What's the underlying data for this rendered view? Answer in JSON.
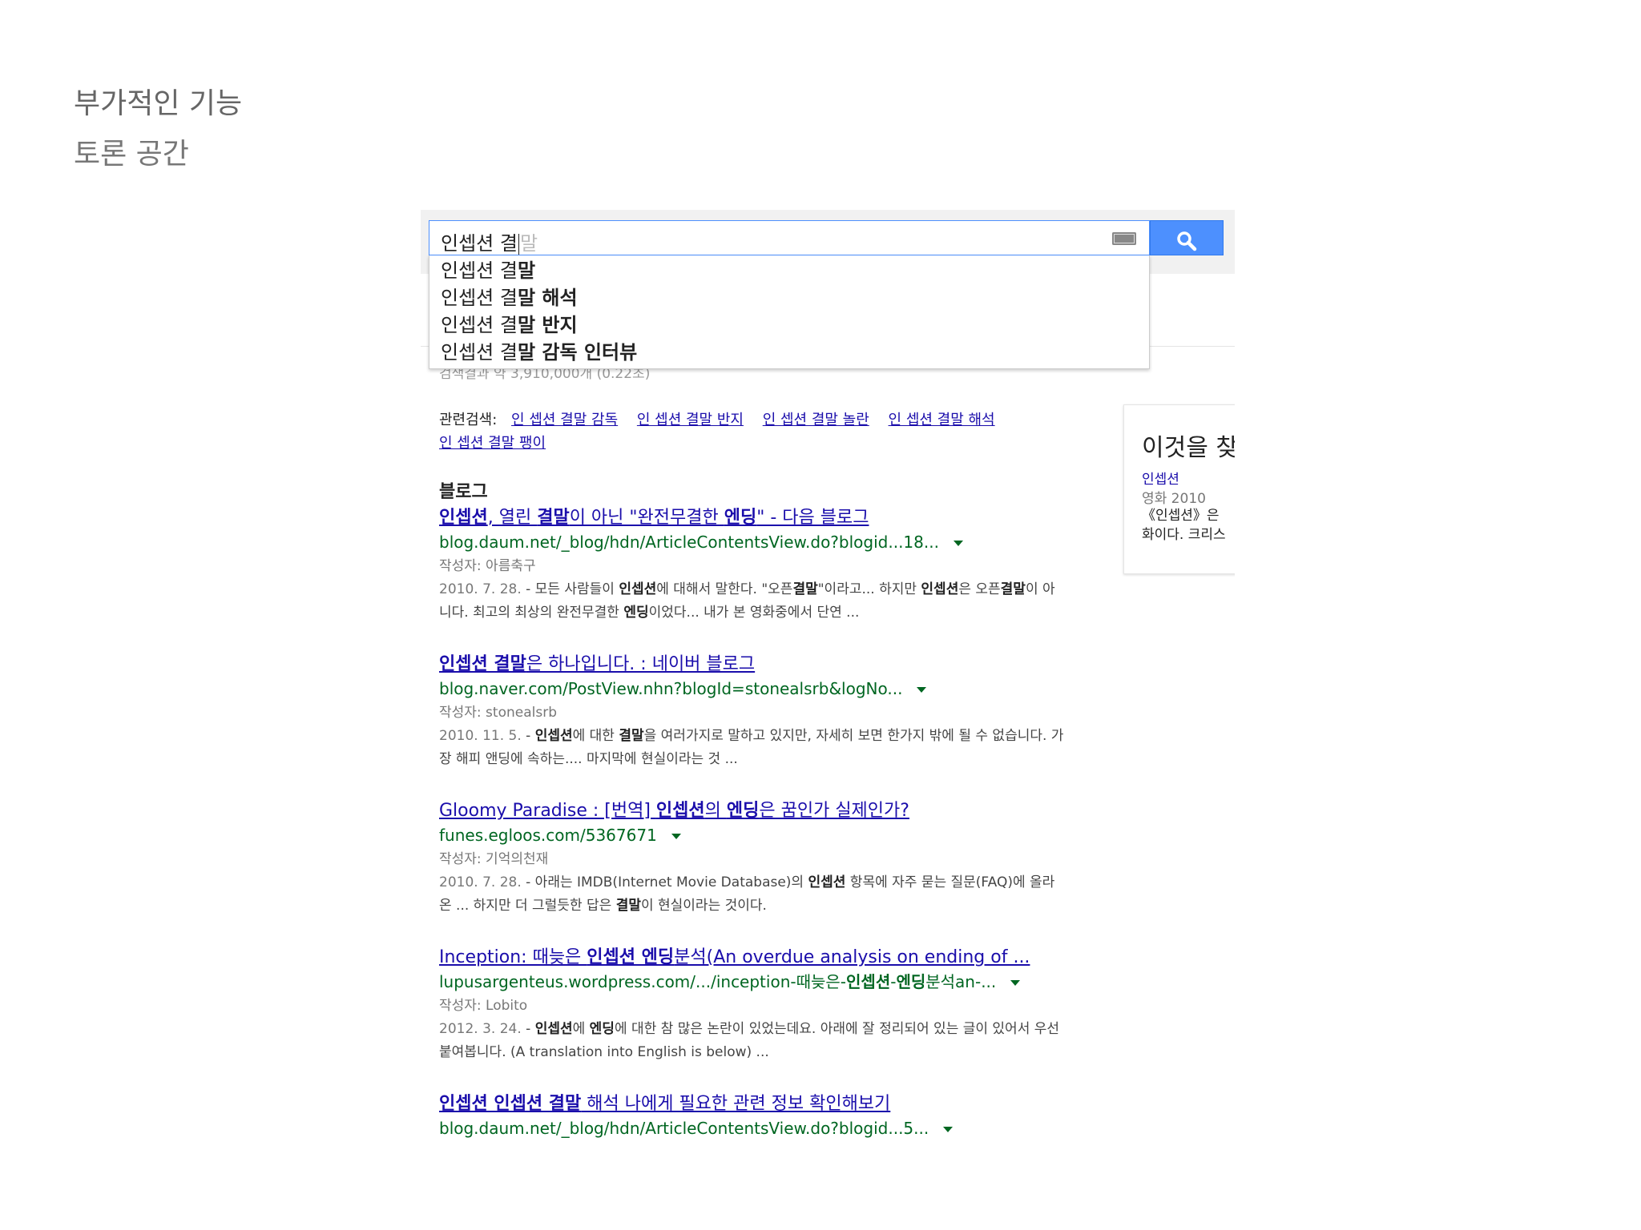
{
  "slide": {
    "heading": "부가적인 기능",
    "subheading": "토론 공간"
  },
  "search": {
    "query": "인셉션 결",
    "hint": "말",
    "keyboard_icon": "keyboard-icon",
    "button_icon": "search-icon",
    "accent_color": "#4d90fe"
  },
  "suggestions": [
    {
      "prefix": "인셉션 결",
      "suffix": "말"
    },
    {
      "prefix": "인셉션 결",
      "suffix": "말 해석"
    },
    {
      "prefix": "인셉션 결",
      "suffix": "말 반지"
    },
    {
      "prefix": "인셉션 결",
      "suffix": "말 감독 인터뷰"
    }
  ],
  "results_stats": "검색결과 약 3,910,000개 (0.22초)",
  "related": {
    "label": "관련검색:",
    "links": [
      "인 셉션 결말 감독",
      "인 셉션 결말 반지",
      "인 셉션 결말 놀란",
      "인 셉션 결말 해석",
      "인 셉션 결말 팽이"
    ]
  },
  "section_title": "블로그",
  "results": [
    {
      "title_1": "인셉션",
      "title_2": ", 열린 ",
      "title_3": "결말",
      "title_4": "이 아닌 \"완전무결한 ",
      "title_5": "엔딩",
      "title_6": "\" - 다음 블로그",
      "url": "blog.daum.net/_blog/hdn/ArticleContentsView.do?blogid...18...",
      "author": "작성자: 아름축구",
      "date": "2010. 7. 28.",
      "s1": " - 모든 사람들이 ",
      "s2": "인셉션",
      "s3": "에 대해서 말한다. \"오픈",
      "s4": "결말",
      "s5": "\"이라고... 하지만 ",
      "s6": "인셉션",
      "s7": "은 오픈",
      "s8": "결말",
      "s9": "이 아니다. 최고의 최상의 완전무결한 ",
      "s10": "엔딩",
      "s11": "이었다... 내가 본 영화중에서 단연 ..."
    },
    {
      "title_1": "인셉션 결말",
      "title_2": "은 하나입니다. : 네이버 블로그",
      "url": "blog.naver.com/PostView.nhn?blogId=stonealsrb&logNo...",
      "author": "작성자: stonealsrb",
      "date": "2010. 11. 5.",
      "s1": " - ",
      "s2": "인셉션",
      "s3": "에 대한 ",
      "s4": "결말",
      "s5": "을 여러가지로 말하고 있지만, 자세히 보면 한가지 밖에 될 수 없습니다. 가장 해피 앤딩에 속하는.... 마지막에 현실이라는 것 ..."
    },
    {
      "title_1": "Gloomy Paradise : [번역] ",
      "title_2": "인셉션",
      "title_3": "의 ",
      "title_4": "엔딩",
      "title_5": "은 꿈인가 실제인가?",
      "url": "funes.egloos.com/5367671",
      "author": "작성자: 기억의천재",
      "date": "2010. 7. 28.",
      "s1": " - 아래는 IMDB(Internet Movie Database)의 ",
      "s2": "인셉션",
      "s3": " 항목에 자주 묻는 질문(FAQ)에 올라온 ... 하지만 더 그럴듯한 답은 ",
      "s4": "결말",
      "s5": "이 현실이라는 것이다."
    },
    {
      "title_1": "Inception: 때늦은 ",
      "title_2": "인셉션 엔딩",
      "title_3": "분석(An overdue analysis on ending of ...",
      "url_1": "lupusargenteus.wordpress.com/.../inception-때늦은-",
      "url_2": "인셉션",
      "url_3": "-",
      "url_4": "엔딩",
      "url_5": "분석an-...",
      "author": "작성자: Lobito",
      "date": "2012. 3. 24.",
      "s1": " - ",
      "s2": "인셉션",
      "s3": "에 ",
      "s4": "엔딩",
      "s5": "에 대한 참 많은 논란이 있었는데요. 아래에 잘 정리되어 있는 글이 있어서 우선 붙여봅니다. (A translation into English is below) ..."
    },
    {
      "title_1": "인셉션 인셉션 결말",
      "title_2": " 해석 나에게 필요한 관련 정보 확인해보기",
      "url": "blog.daum.net/_blog/hdn/ArticleContentsView.do?blogid...5..."
    }
  ],
  "knowledge_panel": {
    "title": "이것을 찾",
    "link": "인셉션",
    "subtitle": "영화 2010",
    "desc_1": "《인셉션》은",
    "desc_2": "화이다. 크리스"
  }
}
